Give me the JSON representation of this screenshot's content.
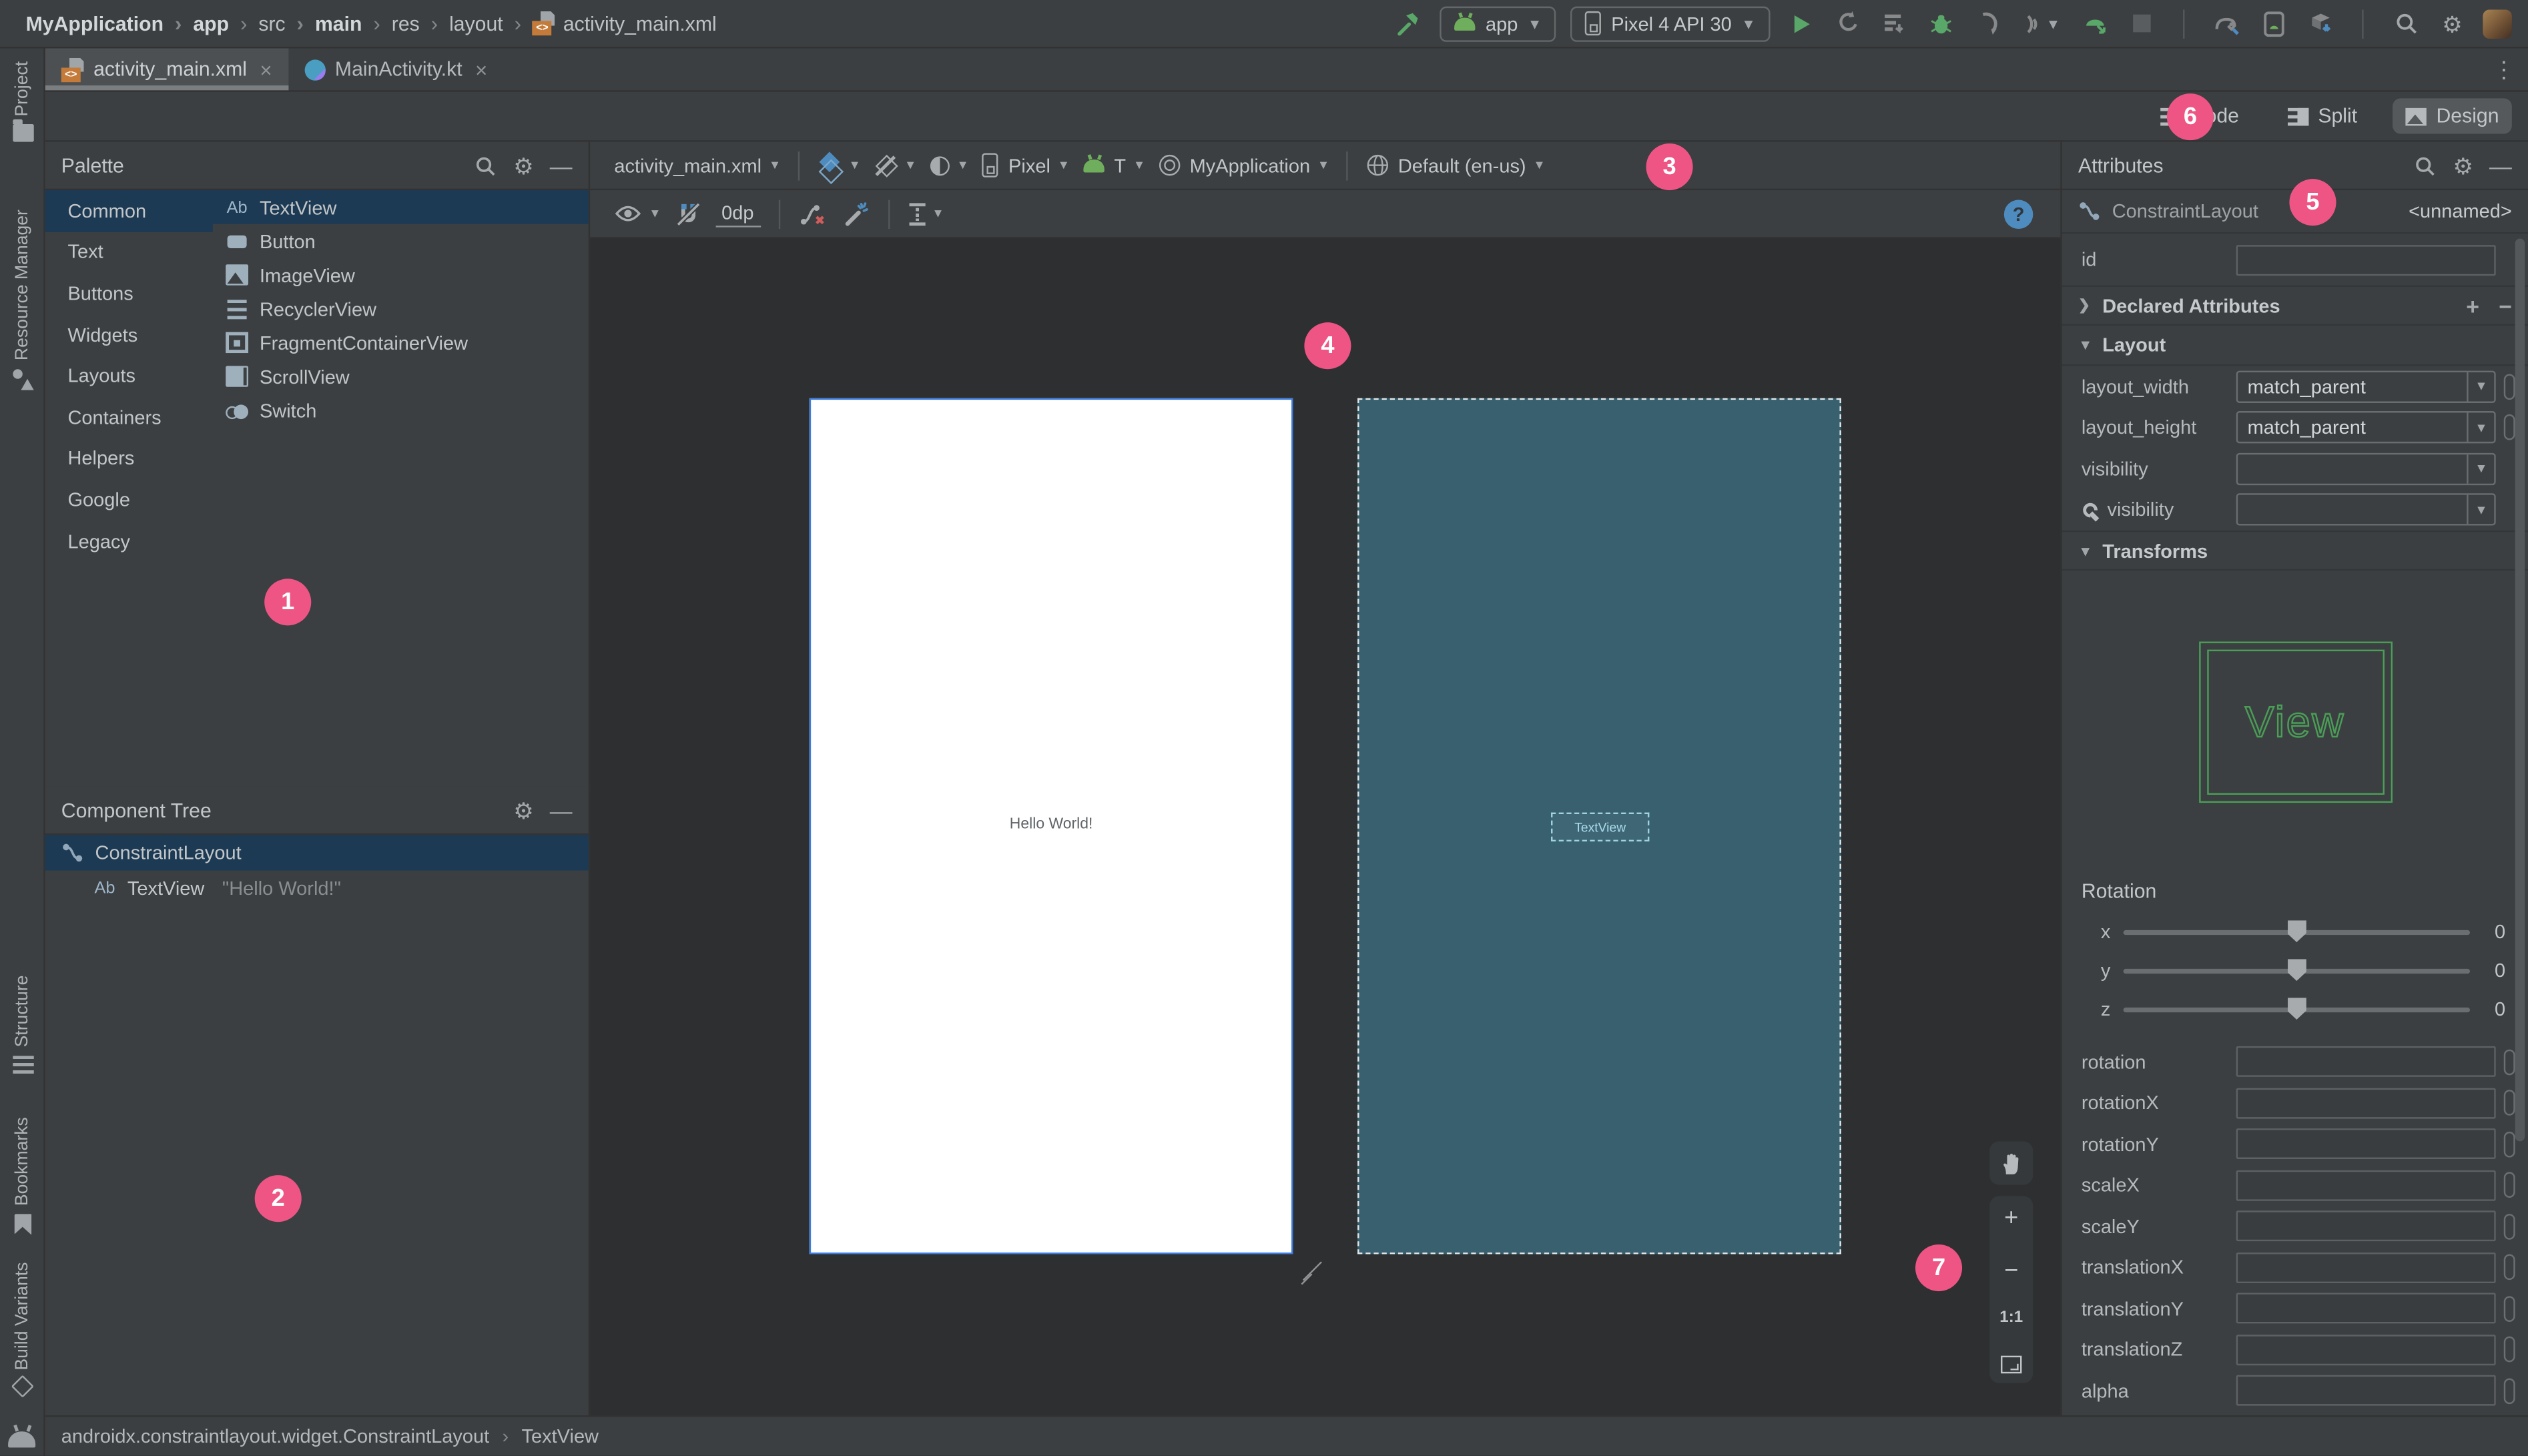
{
  "top_toolbar": {
    "breadcrumbs": [
      {
        "label": "MyApplication",
        "bold": true
      },
      {
        "label": "app",
        "bold": true
      },
      {
        "label": "src",
        "bold": false
      },
      {
        "label": "main",
        "bold": true
      },
      {
        "label": "res",
        "bold": false
      },
      {
        "label": "layout",
        "bold": false
      },
      {
        "label": "activity_main.xml",
        "bold": false,
        "icon": "xml-file"
      }
    ],
    "run_config": "app",
    "device": "Pixel 4 API 30"
  },
  "tabs": [
    {
      "label": "activity_main.xml",
      "active": true,
      "icon": "xml"
    },
    {
      "label": "MainActivity.kt",
      "active": false,
      "icon": "kt"
    }
  ],
  "tool_strip": {
    "project": "Project",
    "resource_manager": "Resource Manager",
    "structure": "Structure",
    "bookmarks": "Bookmarks",
    "build_variants": "Build Variants"
  },
  "view_modes": [
    {
      "label": "Code",
      "icon": "code",
      "active": false
    },
    {
      "label": "Split",
      "icon": "split",
      "active": false
    },
    {
      "label": "Design",
      "icon": "design",
      "active": true
    }
  ],
  "palette": {
    "title": "Palette",
    "categories": [
      {
        "label": "Common",
        "selected": true
      },
      {
        "label": "Text"
      },
      {
        "label": "Buttons"
      },
      {
        "label": "Widgets"
      },
      {
        "label": "Layouts"
      },
      {
        "label": "Containers"
      },
      {
        "label": "Helpers"
      },
      {
        "label": "Google"
      },
      {
        "label": "Legacy"
      }
    ],
    "components": [
      {
        "label": "TextView",
        "icon": "ab",
        "selected": true
      },
      {
        "label": "Button",
        "icon": "button"
      },
      {
        "label": "ImageView",
        "icon": "image"
      },
      {
        "label": "RecyclerView",
        "icon": "recycler"
      },
      {
        "label": "FragmentContainerView",
        "icon": "fragment"
      },
      {
        "label": "ScrollView",
        "icon": "scroll"
      },
      {
        "label": "Switch",
        "icon": "switch"
      }
    ]
  },
  "component_tree": {
    "title": "Component Tree",
    "root_label": "ConstraintLayout",
    "child_label": "TextView",
    "child_detail": "\"Hello World!\""
  },
  "design_toolbar": {
    "file": "activity_main.xml",
    "device": "Pixel",
    "api": "T",
    "theme": "MyApplication",
    "locale": "Default (en-us)",
    "margin": "0dp",
    "help": "?"
  },
  "canvas": {
    "hello_text": "Hello World!",
    "blueprint_textview": "TextView"
  },
  "zoom_controls": {
    "zoom_in": "+",
    "zoom_out": "−",
    "actual_size": "1:1"
  },
  "attributes": {
    "title": "Attributes",
    "component_type": "ConstraintLayout",
    "component_name": "<unnamed>",
    "id_label": "id",
    "id_value": "",
    "declared_section": "Declared Attributes",
    "layout_section": "Layout",
    "transforms_section": "Transforms",
    "layout_rows": [
      {
        "label": "layout_width",
        "value": "match_parent",
        "combo": true
      },
      {
        "label": "layout_height",
        "value": "match_parent",
        "combo": true
      },
      {
        "label": "visibility",
        "value": "",
        "combo": true,
        "pill": false
      },
      {
        "label": "visibility",
        "value": "",
        "combo": true,
        "pill": false,
        "tools": true
      }
    ],
    "preview_text": "View",
    "rotation_label": "Rotation",
    "sliders": [
      {
        "axis": "x",
        "value": "0"
      },
      {
        "axis": "y",
        "value": "0"
      },
      {
        "axis": "z",
        "value": "0"
      }
    ],
    "fields": [
      {
        "label": "rotation"
      },
      {
        "label": "rotationX"
      },
      {
        "label": "rotationY"
      },
      {
        "label": "scaleX"
      },
      {
        "label": "scaleY"
      },
      {
        "label": "translationX"
      },
      {
        "label": "translationY"
      },
      {
        "label": "translationZ"
      },
      {
        "label": "alpha"
      }
    ]
  },
  "status_bar": {
    "class_path": "androidx.constraintlayout.widget.ConstraintLayout",
    "selected": "TextView"
  },
  "badges": [
    {
      "n": "1"
    },
    {
      "n": "2"
    },
    {
      "n": "3"
    },
    {
      "n": "4"
    },
    {
      "n": "5"
    },
    {
      "n": "6"
    },
    {
      "n": "7"
    }
  ],
  "colors": {
    "accent_pink": "#ee5585",
    "selection_blue": "#1c3a54",
    "android_green": "#59A869",
    "blueprint_teal": "#38606f",
    "help_blue": "#4e8cbf",
    "design_border_blue": "#3e7ee0"
  }
}
